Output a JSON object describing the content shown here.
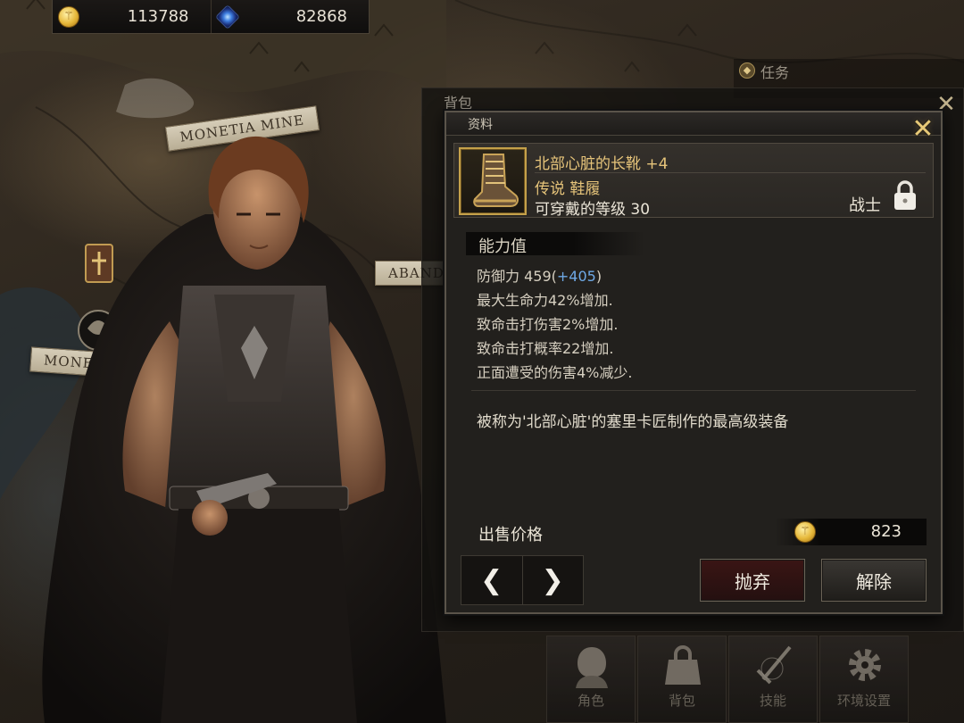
{
  "currency": {
    "gold": {
      "icon": "gold-coin-icon",
      "value": "113788"
    },
    "gems": {
      "icon": "blue-gem-icon",
      "value": "82868"
    }
  },
  "map": {
    "labels": [
      "MONETIA MINE",
      "MONETI",
      "ABAND"
    ]
  },
  "quest": {
    "title": "任务",
    "icon": "quest-icon"
  },
  "bag_window": {
    "title": "背包"
  },
  "dialog": {
    "title": "资料",
    "item": {
      "name": "北部心脏的长靴 +4",
      "type": "传说 鞋履",
      "level_text": "可穿戴的等级 30",
      "class": "战士",
      "icon": "boots-icon",
      "locked": true
    },
    "stats_header": "能力值",
    "stats": [
      {
        "text": "防御力 459(",
        "plus": "+405",
        "suffix": ")"
      },
      {
        "text": "最大生命力42%增加."
      },
      {
        "text": "致命击打伤害2%增加."
      },
      {
        "text": "致命击打概率22增加."
      },
      {
        "text": "正面遭受的伤害4%减少."
      }
    ],
    "description": "被称为'北部心脏'的塞里卡匠制作的最高级装备",
    "sell": {
      "label": "出售价格",
      "value": "823"
    },
    "buttons": {
      "discard": "抛弃",
      "unequip": "解除"
    }
  },
  "bottom_menu": [
    {
      "label": "角色",
      "icon": "character-icon"
    },
    {
      "label": "背包",
      "icon": "bag-icon"
    },
    {
      "label": "技能",
      "icon": "skill-icon"
    },
    {
      "label": "环境设置",
      "icon": "settings-icon"
    }
  ],
  "colors": {
    "item_gold": "#e6c47a",
    "stat_plus_blue": "#6fa9e6",
    "discard_red": "#3a1514"
  }
}
